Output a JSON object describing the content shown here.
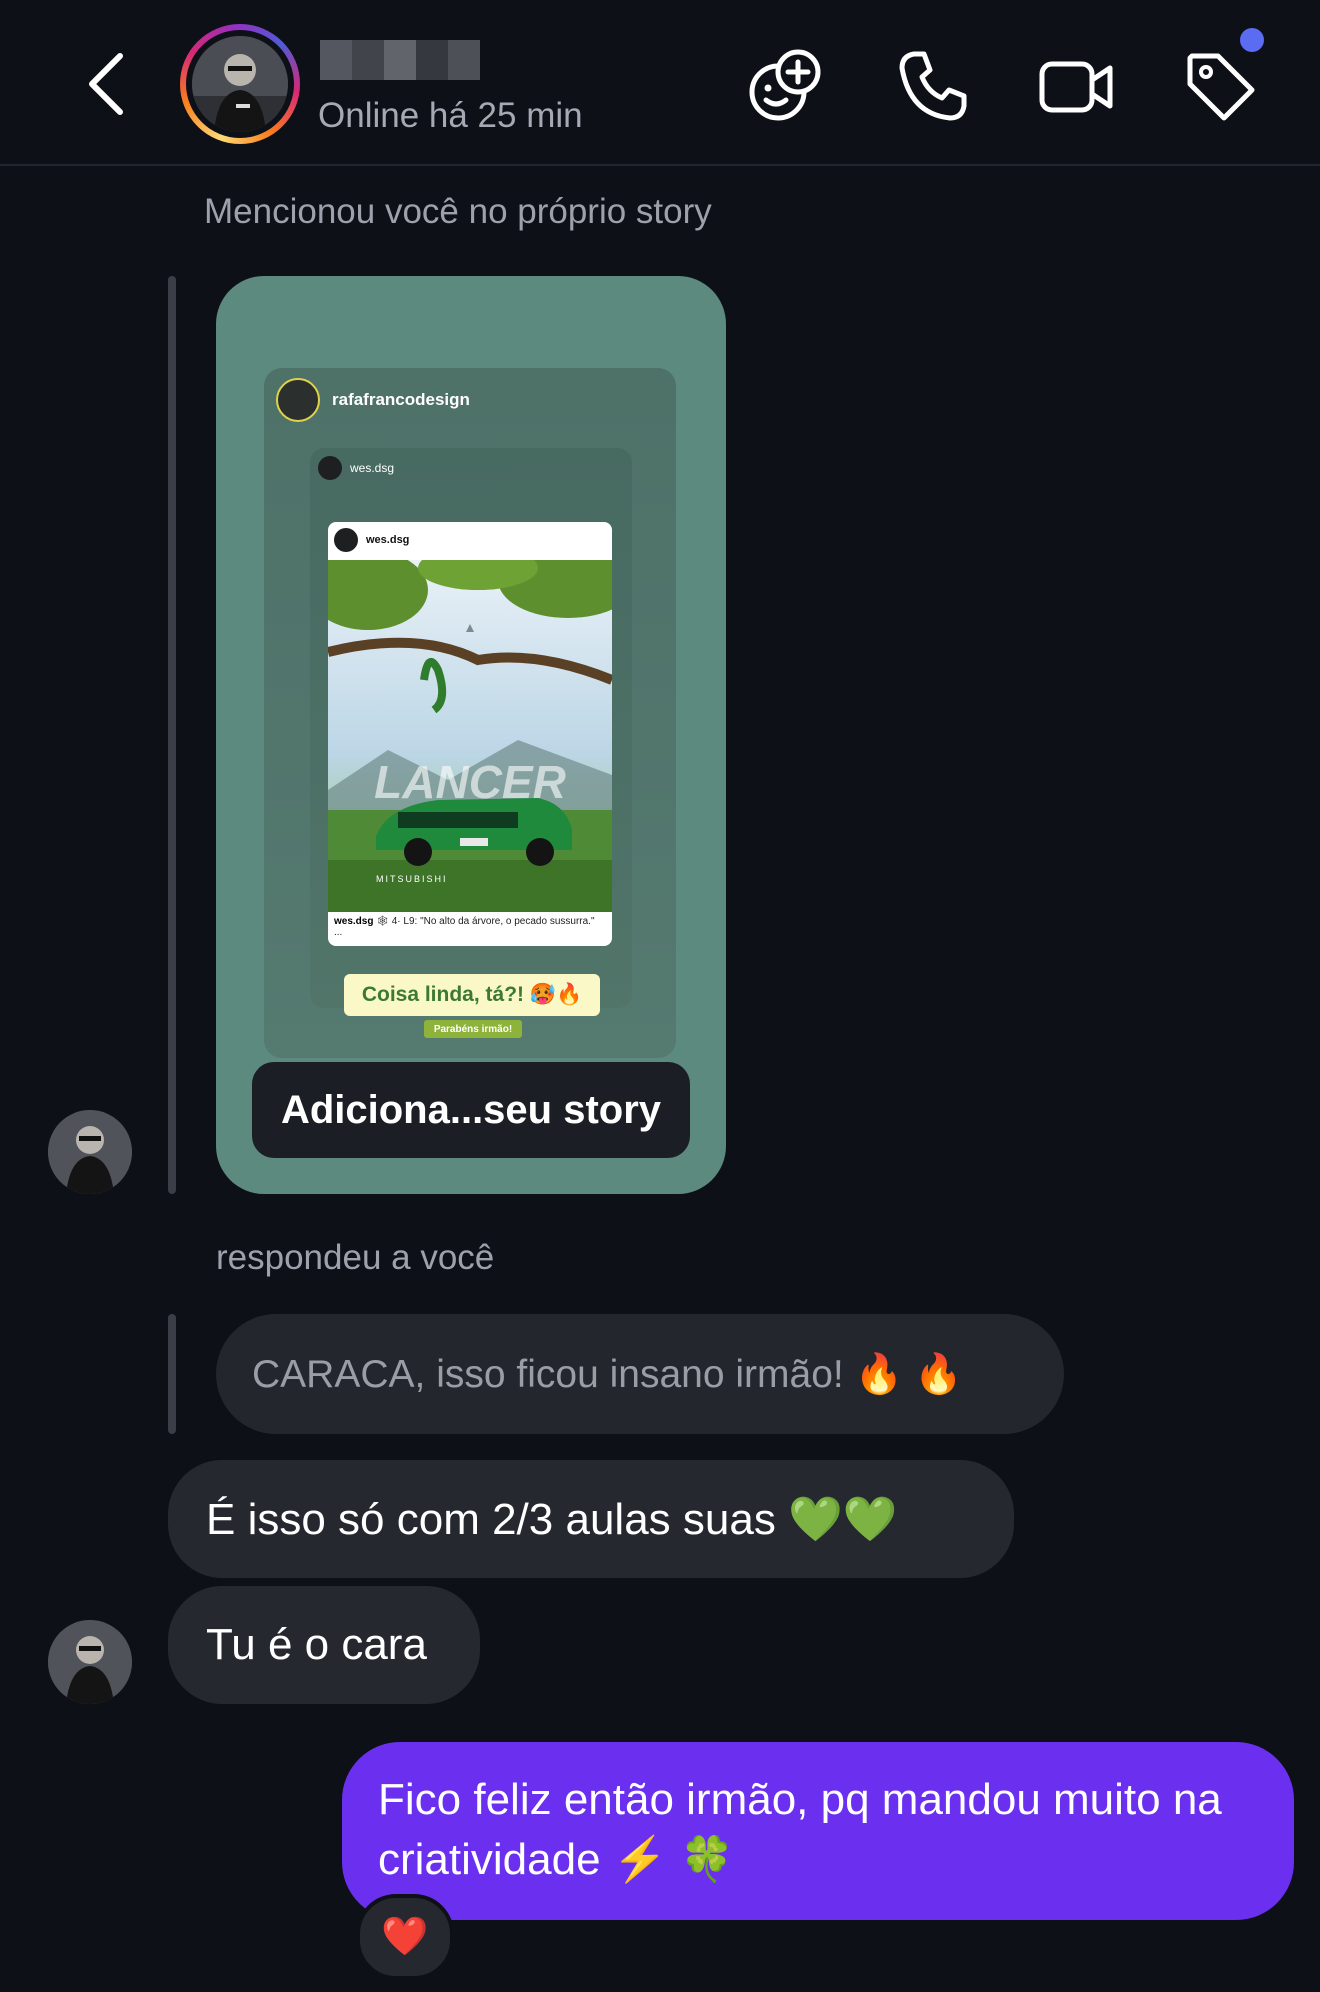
{
  "header": {
    "status": "Online há 25 min",
    "back_icon": "chevron-left-icon",
    "actions": [
      "add-effect-icon",
      "phone-icon",
      "video-camera-icon",
      "tag-icon"
    ],
    "notification_dot_color": "#5b6cf2"
  },
  "story_mention": {
    "label": "Mencionou você no próprio story",
    "story_username": "rafafrancodesign",
    "inner_username": "wes.dsg",
    "post_username": "wes.dsg",
    "post_caption_user": "wes.dsg",
    "post_caption_text": "🕸 4· L9: \"No alto da árvore, o pecado sussurra.\" ...",
    "artwork_text": "LANCER",
    "brand_text": "MITSUBISHI",
    "sticker_text": "Coisa linda, tá?! 🥵🔥",
    "sticker_subtext": "Parabéns irmão!",
    "add_button_label": "Adiciona...seu story"
  },
  "reply": {
    "label": "respondeu a você",
    "quoted_text": "CARACA, isso ficou insano irmão! 🔥 🔥"
  },
  "messages": [
    {
      "from": "peer",
      "text": "É isso só com 2/3 aulas suas 💚💚"
    },
    {
      "from": "peer",
      "text": "Tu é o cara"
    },
    {
      "from": "me",
      "text": "Fico feliz então irmão, pq mandou muito na criatividade ⚡️ 🍀"
    }
  ],
  "reaction": "❤️",
  "colors": {
    "background": "#0e1018",
    "peer_bubble": "#262830",
    "my_bubble": "#6b2ff0",
    "story_card": "#5c8a7e"
  }
}
